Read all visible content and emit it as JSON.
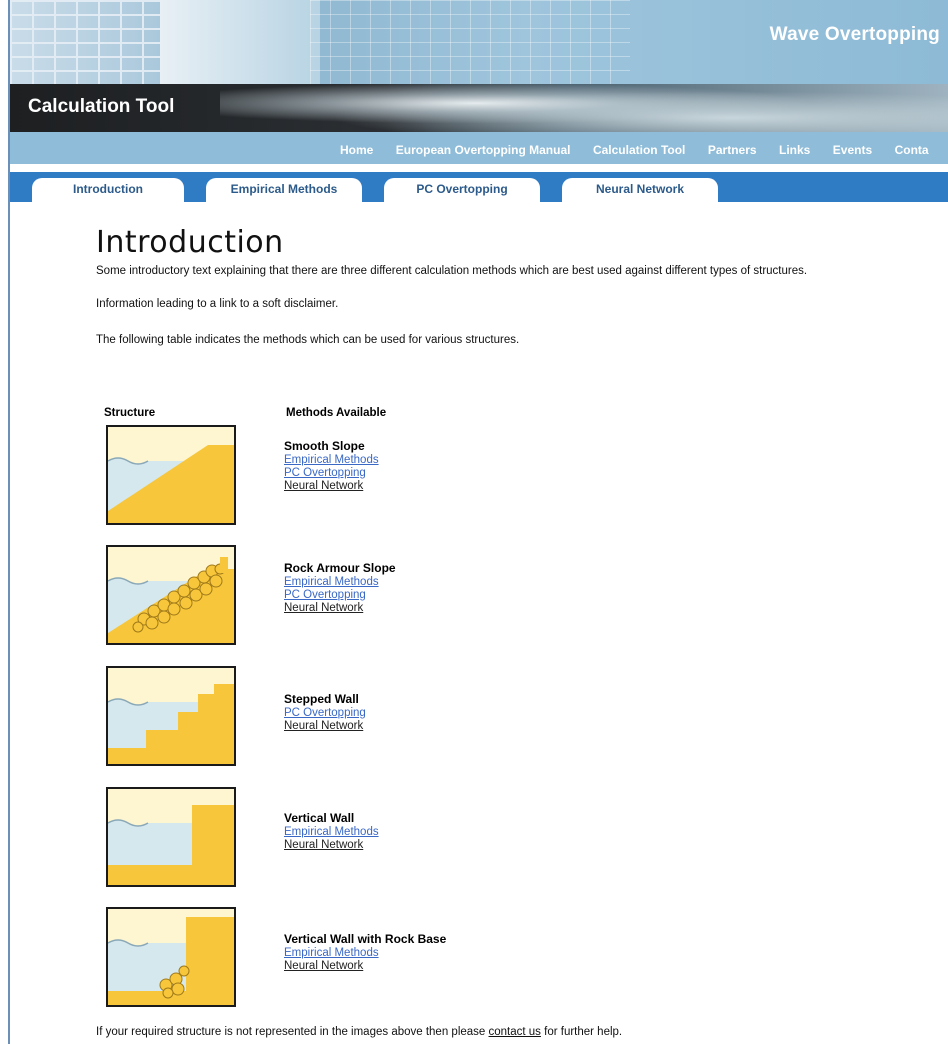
{
  "header": {
    "site_title": "Wave Overtopping",
    "tool_title": "Calculation Tool"
  },
  "topnav": {
    "items": [
      "Home",
      "European Overtopping Manual",
      "Calculation Tool",
      "Partners",
      "Links",
      "Events",
      "Conta"
    ]
  },
  "tabs": [
    {
      "label": "Introduction",
      "active": true
    },
    {
      "label": "Empirical Methods",
      "active": false
    },
    {
      "label": "PC Overtopping",
      "active": false
    },
    {
      "label": "Neural Network",
      "active": false
    }
  ],
  "main": {
    "title": "Introduction",
    "intro_text": "Some introductory text explaining that there are three different calculation methods which are best used against different types of structures.",
    "disclaimer_text": "Information leading to a link to a soft disclaimer.",
    "table_text": "The following table indicates the methods which can be used for various structures.",
    "structure_header": "Structure",
    "methods_header": "Methods Available",
    "structures": [
      {
        "name": "Smooth Slope",
        "methods": [
          "Empirical Methods",
          "PC Overtopping",
          "Neural Network"
        ],
        "icon": "smooth-slope-icon"
      },
      {
        "name": "Rock Armour Slope",
        "methods": [
          "Empirical Methods",
          "PC Overtopping",
          "Neural Network"
        ],
        "icon": "rock-armour-slope-icon"
      },
      {
        "name": "Stepped Wall",
        "methods": [
          "PC Overtopping",
          "Neural Network"
        ],
        "icon": "stepped-wall-icon"
      },
      {
        "name": "Vertical Wall",
        "methods": [
          "Empirical Methods",
          "Neural Network"
        ],
        "icon": "vertical-wall-icon"
      },
      {
        "name": "Vertical Wall with Rock Base",
        "methods": [
          "Empirical Methods",
          "Neural Network"
        ],
        "icon": "vertical-wall-rock-base-icon"
      }
    ],
    "footer_before": "If your required structure is not represented in the images above then please ",
    "footer_link": "contact us",
    "footer_after": " for further help."
  },
  "colors": {
    "tab_bar": "#2f7bc4",
    "nav_bar": "#8fbcd8",
    "link": "#3a68c5",
    "sand": "#f7c63a",
    "water": "#d5e8ee"
  }
}
